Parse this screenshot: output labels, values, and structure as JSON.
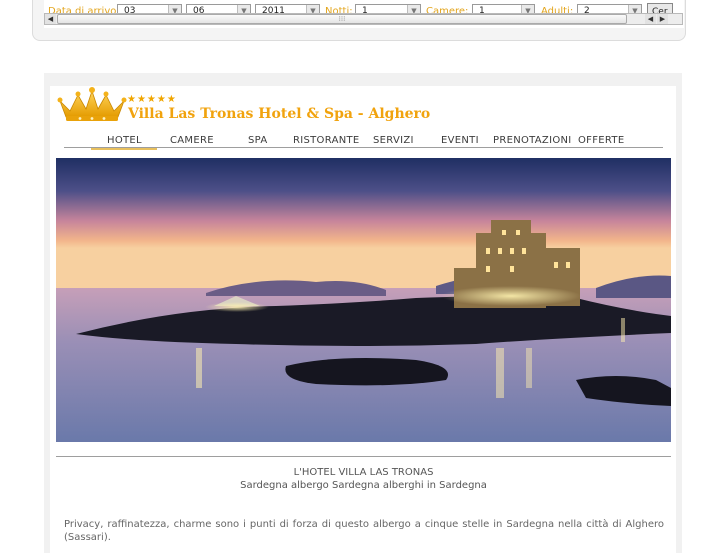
{
  "booking": {
    "arrival_label": "Data di arrivo:",
    "day": "03",
    "month": "06",
    "year": "2011",
    "nights_label": "Notti:",
    "nights": "1",
    "rooms_label": "Camere:",
    "rooms": "1",
    "adults_label": "Adulti:",
    "adults": "2",
    "search_button": "Cer"
  },
  "site": {
    "stars": "★★★★★",
    "title": "Villa Las Tronas Hotel & Spa - Alghero"
  },
  "nav": {
    "items": [
      {
        "label": "HOTEL"
      },
      {
        "label": "CAMERE"
      },
      {
        "label": "SPA"
      },
      {
        "label": "RISTORANTE"
      },
      {
        "label": "SERVIZI"
      },
      {
        "label": "EVENTI"
      },
      {
        "label": "PRENOTAZIONI"
      },
      {
        "label": "OFFERTE"
      }
    ],
    "active": "HOTEL"
  },
  "content": {
    "caption_title": "L'HOTEL VILLA LAS TRONAS",
    "caption_sub": "Sardegna albergo Sardegna alberghi in Sardegna",
    "intro": "Privacy, raffinatezza, charme sono i punti di forza di questo albergo a cinque stelle in Sardegna nella città di Alghero (Sassari)."
  },
  "colors": {
    "accent": "#f1a30e",
    "label_orange": "#e3a51c",
    "nav_text": "#3c3c3c",
    "divider": "#9e9e9e"
  }
}
